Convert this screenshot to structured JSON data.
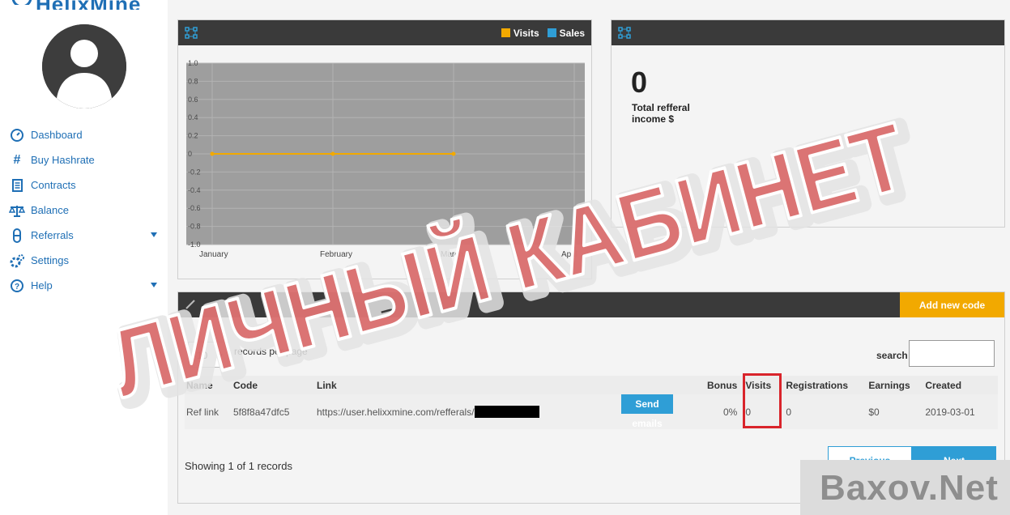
{
  "brand": {
    "name": "HelixMine"
  },
  "sidebar": {
    "items": [
      {
        "label": "Dashboard",
        "icon": "dashboard-icon"
      },
      {
        "label": "Buy Hashrate",
        "icon": "hash-icon"
      },
      {
        "label": "Contracts",
        "icon": "contract-icon"
      },
      {
        "label": "Balance",
        "icon": "scales-icon"
      },
      {
        "label": "Referrals",
        "icon": "referrals-icon",
        "expandable": true
      },
      {
        "label": "Settings",
        "icon": "gears-icon"
      },
      {
        "label": "Help",
        "icon": "help-icon",
        "expandable": true
      }
    ]
  },
  "chart_panel": {
    "legend": [
      {
        "name": "Visits",
        "color": "#f2a900"
      },
      {
        "name": "Sales",
        "color": "#2f9ed6"
      }
    ]
  },
  "chart_data": {
    "type": "line",
    "categories": [
      "January",
      "February",
      "March",
      "April"
    ],
    "series": [
      {
        "name": "Visits",
        "values": [
          0,
          0,
          0
        ]
      }
    ],
    "yticks": [
      "1.0",
      "0.8",
      "0.6",
      "0.4",
      "0.2",
      "0",
      "-0.2",
      "-0.4",
      "-0.6",
      "-0.8",
      "-1.0"
    ],
    "ylim": [
      -1,
      1
    ],
    "grid": true,
    "legend_position": "top-right"
  },
  "income_panel": {
    "value": "0",
    "label": "Total refferal income $"
  },
  "referral_panel": {
    "add_button": "Add new code",
    "records_per_page_value": "10",
    "records_per_page_label": "records per page",
    "search_label": "search",
    "columns": [
      "Name",
      "Code",
      "Link",
      "",
      "Bonus",
      "Visits",
      "Registrations",
      "Earnings",
      "Created"
    ],
    "rows": [
      {
        "name": "Ref link",
        "code": "5f8f8a47dfc5",
        "link": "https://user.helixxmine.com/refferals/",
        "send_button": "Send emails",
        "bonus": "0%",
        "visits": "0",
        "registrations": "0",
        "earnings": "$0",
        "created": "2019-03-01"
      }
    ],
    "showing": "Showing 1 of 1 records",
    "previous": "Previous",
    "next": "Next"
  },
  "overlays": {
    "watermark_text": "ЛИЧНЫЙ КАБИНЕТ",
    "watermark_color": "#d85a5a",
    "site_mark": "Baxov.Net"
  }
}
